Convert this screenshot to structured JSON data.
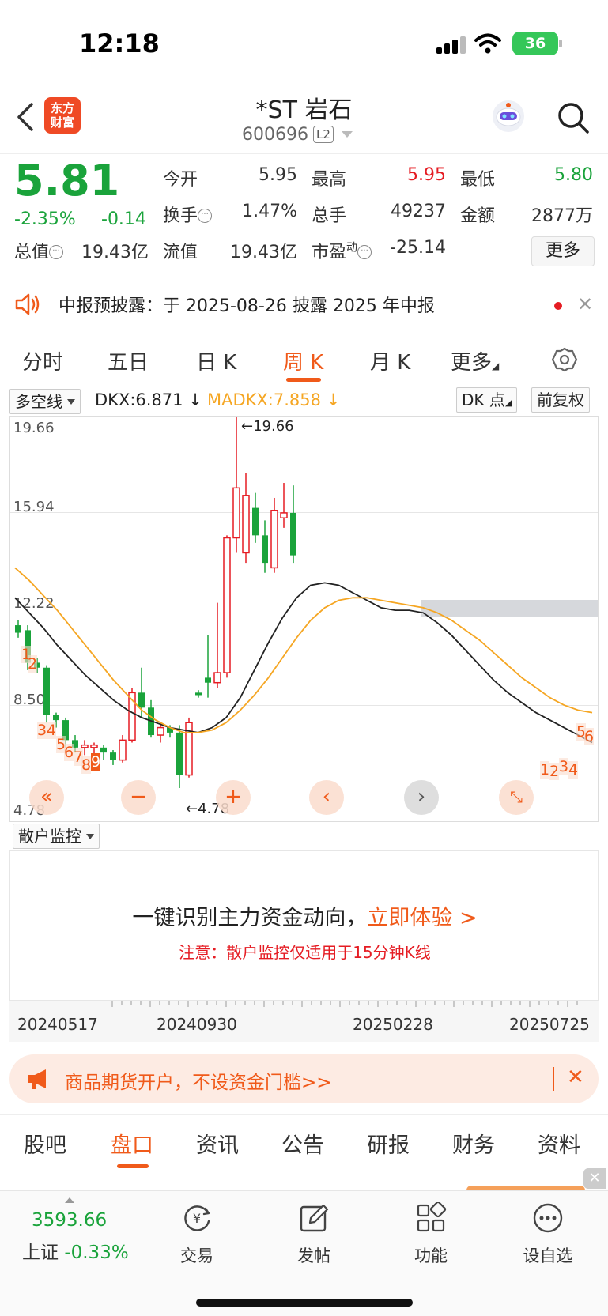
{
  "status": {
    "time": "12:18",
    "battery": "36"
  },
  "header": {
    "logo_line1": "东方",
    "logo_line2": "财富",
    "stock_name": "*ST 岩石",
    "stock_code": "600696",
    "level_badge": "L2"
  },
  "quote": {
    "price": "5.81",
    "change_pct": "-2.35%",
    "change": "-0.14",
    "fields": {
      "open_label": "今开",
      "open": "5.95",
      "high_label": "最高",
      "high": "5.95",
      "low_label": "最低",
      "low": "5.80",
      "turnover_label": "换手",
      "turnover": "1.47%",
      "volume_label": "总手",
      "volume": "49237",
      "amount_label": "金额",
      "amount": "2877万",
      "mktcap_label": "总值",
      "mktcap": "19.43亿",
      "float_label": "流值",
      "float_cap": "19.43亿",
      "pe_label": "市盈",
      "pe_sup": "动",
      "pe": "-25.14"
    },
    "more_label": "更多"
  },
  "notice": {
    "text": "中报预披露：于 2025-08-26 披露 2025 年中报"
  },
  "period_tabs": [
    "分时",
    "五日",
    "日 K",
    "周 K",
    "月 K",
    "更多"
  ],
  "period_active": "周 K",
  "chart_toolbar": {
    "indicator": "多空线",
    "dkx": "DKX:6.871",
    "madkx": "MADKX:7.858",
    "dk_point": "DK 点",
    "adjust": "前复权"
  },
  "chart_data": {
    "type": "candlestick",
    "y_ticks": [
      "19.66",
      "15.94",
      "12.22",
      "8.50",
      "4.78"
    ],
    "ylim": [
      4.78,
      19.66
    ],
    "max_marker": "19.66",
    "min_marker": "4.78",
    "x_ticks": [
      "20240517",
      "20240930",
      "20250228",
      "20250725"
    ],
    "series": [
      {
        "name": "DKX",
        "values": [
          12.4,
          11.8,
          11.2,
          10.5,
          9.9,
          9.3,
          8.8,
          8.3,
          7.9,
          7.6,
          7.4,
          7.2,
          7.1,
          7.0,
          7.2,
          7.6,
          8.4,
          9.5,
          10.6,
          11.6,
          12.4,
          12.9,
          13.0,
          12.9,
          12.6,
          12.3,
          12.0,
          11.9,
          11.9,
          11.8,
          11.4,
          10.9,
          10.3,
          9.7,
          9.1,
          8.6,
          8.2,
          7.8,
          7.5,
          7.2,
          6.9,
          6.6
        ]
      },
      {
        "name": "MADKX",
        "values": [
          13.6,
          13.1,
          12.5,
          11.9,
          11.2,
          10.5,
          9.8,
          9.1,
          8.5,
          7.9,
          7.5,
          7.2,
          7.0,
          7.0,
          7.1,
          7.4,
          7.9,
          8.5,
          9.2,
          10.0,
          10.8,
          11.5,
          12.0,
          12.3,
          12.4,
          12.4,
          12.3,
          12.2,
          12.1,
          12.0,
          11.8,
          11.5,
          11.1,
          10.7,
          10.2,
          9.7,
          9.2,
          8.8,
          8.4,
          8.1,
          7.9,
          7.8
        ]
      }
    ],
    "candles": [
      {
        "o": 11.3,
        "c": 11.0,
        "h": 11.5,
        "l": 10.8
      },
      {
        "o": 11.1,
        "c": 9.8,
        "h": 11.3,
        "l": 9.5
      },
      {
        "o": 9.8,
        "c": 9.6,
        "h": 10.0,
        "l": 9.4
      },
      {
        "o": 9.6,
        "c": 7.7,
        "h": 9.7,
        "l": 7.4
      },
      {
        "o": 7.7,
        "c": 7.5,
        "h": 7.8,
        "l": 7.2
      },
      {
        "o": 7.5,
        "c": 6.7,
        "h": 7.6,
        "l": 6.4
      },
      {
        "o": 6.7,
        "c": 6.4,
        "h": 6.9,
        "l": 6.2
      },
      {
        "o": 6.4,
        "c": 6.5,
        "h": 6.7,
        "l": 6.1
      },
      {
        "o": 6.4,
        "c": 6.5,
        "h": 6.6,
        "l": 6.0
      },
      {
        "o": 6.4,
        "c": 6.2,
        "h": 6.5,
        "l": 5.9
      },
      {
        "o": 6.2,
        "c": 5.9,
        "h": 6.3,
        "l": 5.7
      },
      {
        "o": 5.9,
        "c": 6.7,
        "h": 6.9,
        "l": 5.8
      },
      {
        "o": 6.7,
        "c": 8.6,
        "h": 8.8,
        "l": 6.6
      },
      {
        "o": 8.6,
        "c": 8.0,
        "h": 9.6,
        "l": 7.6
      },
      {
        "o": 8.0,
        "c": 6.9,
        "h": 8.3,
        "l": 6.8
      },
      {
        "o": 6.9,
        "c": 7.2,
        "h": 7.4,
        "l": 6.6
      },
      {
        "o": 7.2,
        "c": 7.0,
        "h": 7.3,
        "l": 6.8
      },
      {
        "o": 7.0,
        "c": 5.3,
        "h": 7.3,
        "l": 4.78
      },
      {
        "o": 5.3,
        "c": 7.4,
        "h": 7.6,
        "l": 5.2
      },
      {
        "o": 8.6,
        "c": 8.5,
        "h": 8.7,
        "l": 8.4
      },
      {
        "o": 9.2,
        "c": 9.0,
        "h": 10.9,
        "l": 8.4
      },
      {
        "o": 9.0,
        "c": 9.4,
        "h": 12.2,
        "l": 8.8
      },
      {
        "o": 9.4,
        "c": 14.8,
        "h": 14.9,
        "l": 9.2
      },
      {
        "o": 14.8,
        "c": 16.8,
        "h": 19.66,
        "l": 14.2
      },
      {
        "o": 14.2,
        "c": 16.5,
        "h": 17.4,
        "l": 13.8
      },
      {
        "o": 16.0,
        "c": 14.9,
        "h": 16.6,
        "l": 14.6
      },
      {
        "o": 14.9,
        "c": 13.8,
        "h": 15.5,
        "l": 13.4
      },
      {
        "o": 13.6,
        "c": 15.9,
        "h": 16.4,
        "l": 13.4
      },
      {
        "o": 15.6,
        "c": 15.8,
        "h": 17.0,
        "l": 15.2
      },
      {
        "o": 15.8,
        "c": 14.1,
        "h": 16.9,
        "l": 13.8
      }
    ]
  },
  "chart_markers": [
    "1",
    "2",
    "3",
    "4",
    "5",
    "6",
    "7",
    "8",
    "9",
    "1",
    "2",
    "3",
    "4",
    "5",
    "6"
  ],
  "retail": {
    "selector": "散户监控",
    "main": "一键识别主力资金动向，",
    "cta": "立即体验 >",
    "note": "注意：散户监控仅适用于15分钟K线"
  },
  "promo": {
    "text": "商品期货开户，不设资金门槛>>"
  },
  "bottom_tabs": [
    "股吧",
    "盘口",
    "资讯",
    "公告",
    "研报",
    "财务",
    "资料"
  ],
  "bottom_active": "盘口",
  "footer": {
    "index_value": "3593.66",
    "index_name": "上证",
    "index_change": "-0.33%",
    "items": [
      {
        "label": "交易",
        "icon": "yen-exchange-icon"
      },
      {
        "label": "发帖",
        "icon": "edit-post-icon"
      },
      {
        "label": "功能",
        "icon": "grid-apps-icon"
      },
      {
        "label": "设自选",
        "icon": "more-dots-icon"
      }
    ]
  },
  "colors": {
    "up": "#e51c23",
    "down": "#1aa33b",
    "accent": "#f05a1a",
    "madkx": "#f5a623"
  }
}
